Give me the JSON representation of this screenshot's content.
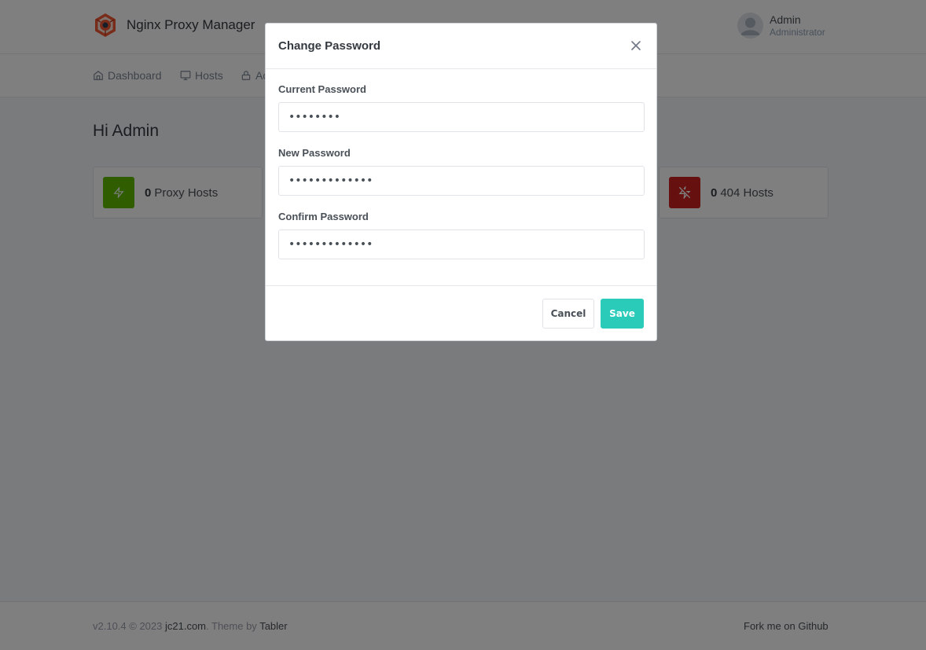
{
  "header": {
    "app_name": "Nginx Proxy Manager",
    "user": {
      "name": "Admin",
      "role": "Administrator"
    }
  },
  "nav": {
    "items": [
      {
        "label": "Dashboard",
        "icon": "home-icon"
      },
      {
        "label": "Hosts",
        "icon": "monitor-icon"
      },
      {
        "label": "Ac",
        "icon": "lock-icon"
      }
    ]
  },
  "main": {
    "greeting": "Hi Admin",
    "stats": [
      {
        "count": "0",
        "label": "Proxy Hosts",
        "color": "#5eba00",
        "icon": "zap-icon"
      },
      {
        "count": "0",
        "label": "404 Hosts",
        "color": "#cd201f",
        "icon": "zap-off-icon"
      }
    ]
  },
  "footer": {
    "version_text": "v2.10.4 © 2023 ",
    "company_link": "jc21.com",
    "theme_text": ". Theme by ",
    "theme_link": "Tabler",
    "fork_link": "Fork me on Github"
  },
  "modal": {
    "title": "Change Password",
    "fields": [
      {
        "label": "Current Password",
        "value": "••••••••"
      },
      {
        "label": "New Password",
        "value": "•••••••••••••"
      },
      {
        "label": "Confirm Password",
        "value": "•••••••••••••"
      }
    ],
    "cancel_label": "Cancel",
    "save_label": "Save",
    "save_color": "#2bcbba"
  }
}
